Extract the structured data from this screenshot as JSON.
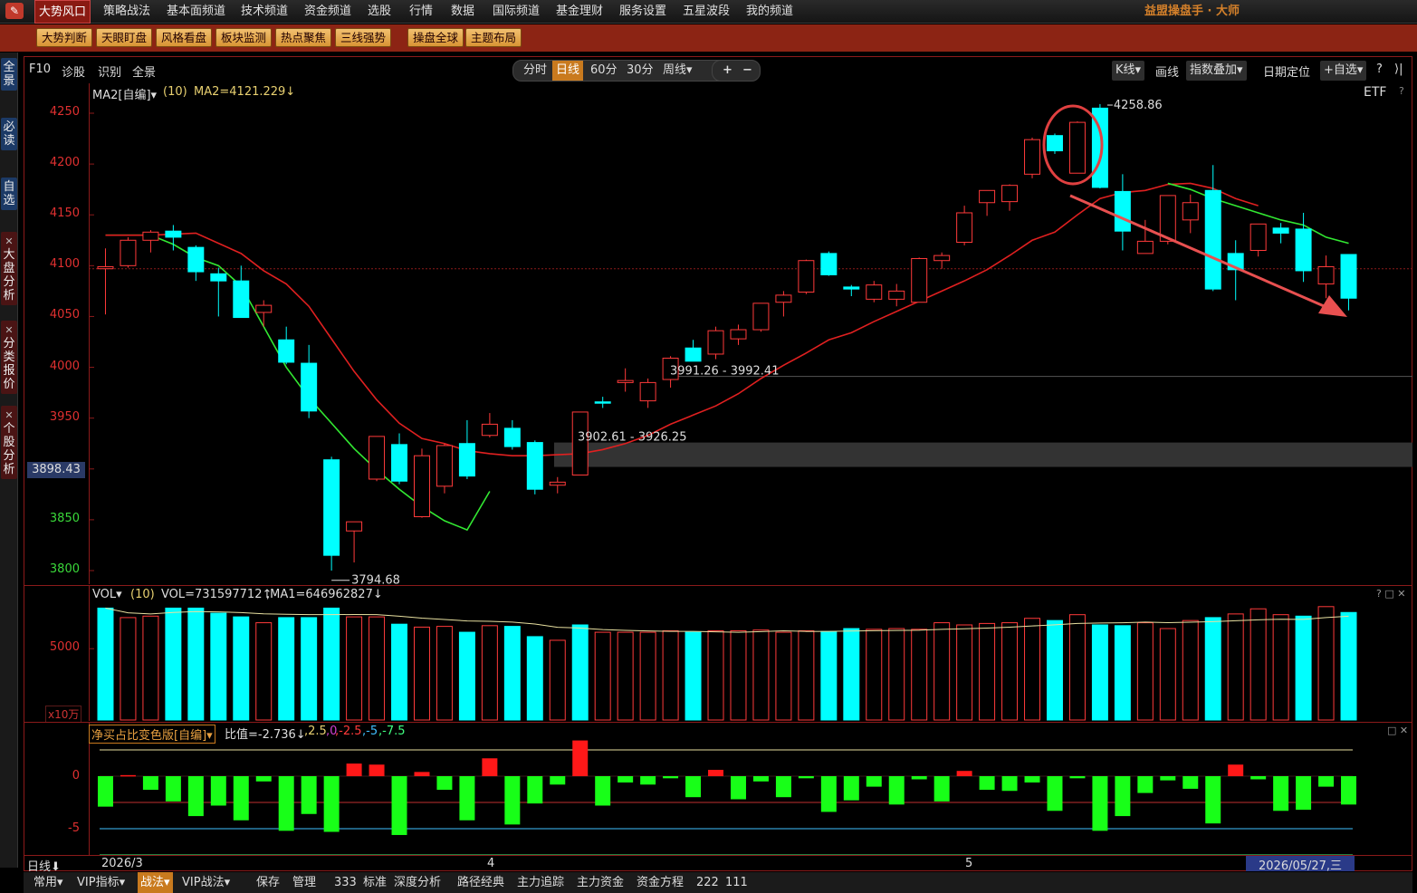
{
  "menu": {
    "items": [
      "大势风口",
      "策略战法",
      "基本面频道",
      "技术频道",
      "资金频道",
      "选股",
      "行情",
      "数据",
      "国际频道",
      "基金理财",
      "服务设置",
      "五星波段",
      "我的频道"
    ],
    "brand": "益盟操盘手 · 大师"
  },
  "subbar": {
    "buttons": [
      "大势判断",
      "天眼盯盘",
      "风格看盘",
      "板块监测",
      "热点聚焦",
      "三线强势",
      "操盘全球",
      "主题布局"
    ]
  },
  "sidebar": {
    "tabs": [
      "全景",
      "必读",
      "自选",
      "大盘分析",
      "分类报价",
      "个股分析"
    ]
  },
  "charttool": {
    "left": [
      "F10",
      "诊股",
      "识别",
      "全景"
    ],
    "periods": [
      "分时",
      "日线",
      "60分",
      "30分",
      "周线▾"
    ],
    "active_period": "日线",
    "zoom": [
      "+",
      "−"
    ],
    "right": {
      "kline": "K线▾",
      "draw": "画线",
      "overlay": "指数叠加▾",
      "date_locate": "日期定位",
      "add_watch": "+自选▾",
      "help": "?",
      "collapse": "⟩|"
    }
  },
  "kpanel": {
    "ma_label": "MA2[自编]▾",
    "ma_period": "(10)",
    "ma_value": "MA2=4121.229↓",
    "etf": "ETF",
    "help": "?",
    "yticks": [
      "4250",
      "4200",
      "4150",
      "4100",
      "4050",
      "4000",
      "3950",
      "3900",
      "3850",
      "3800"
    ],
    "current_price": "3898.43",
    "annotations": {
      "high": "4258.86",
      "low": "3794.68",
      "gap1": "3991.26 - 3992.41",
      "gap2": "3902.61 - 3926.25"
    }
  },
  "volpanel": {
    "label": "VOL▾",
    "period": "(10)",
    "vol": "VOL=731597712↑",
    "ma1": ",MA1=646962827↓",
    "ytick": "5000",
    "unit": "x10万",
    "controls": "? □ ✕"
  },
  "indpanel": {
    "name": "净买占比变色版[自编]▾",
    "ratio": "比值=-2.736↓",
    "levels": [
      ",2.5",
      ",0",
      ",-2.5",
      ",-5",
      ",-7.5"
    ],
    "yticks": [
      "0",
      "-5"
    ],
    "controls": "□ ✕"
  },
  "dateaxis": {
    "period": "日线⬇",
    "labels": [
      "2026/3",
      "4",
      "5"
    ],
    "cursor_date": "2026/05/27,三"
  },
  "bottombar": {
    "items": [
      "常用▾",
      "VIP指标▾",
      "战法▾",
      "VIP战法▾",
      "保存",
      "管理",
      "333",
      "标准",
      "深度分析",
      "路径经典",
      "主力追踪",
      "主力资金",
      "资金方程",
      "222",
      "111"
    ],
    "active": "战法▾"
  },
  "colors": {
    "up": "#ff3a3a",
    "down": "#00ffff",
    "ma_green": "#32e832",
    "ma_red": "#e02020",
    "accent": "#c97a1e",
    "frame": "#8b1a1a"
  },
  "chart_data": {
    "type": "candlestick",
    "price_range": [
      3780,
      4265
    ],
    "candles": [
      {
        "o": 4097,
        "h": 4117,
        "l": 4052,
        "c": 4099
      },
      {
        "o": 4100,
        "h": 4128,
        "l": 4098,
        "c": 4125
      },
      {
        "o": 4125,
        "h": 4135,
        "l": 4113,
        "c": 4133
      },
      {
        "o": 4134,
        "h": 4140,
        "l": 4115,
        "c": 4128
      },
      {
        "o": 4118,
        "h": 4120,
        "l": 4085,
        "c": 4094
      },
      {
        "o": 4092,
        "h": 4098,
        "l": 4050,
        "c": 4085
      },
      {
        "o": 4085,
        "h": 4100,
        "l": 4058,
        "c": 4049
      },
      {
        "o": 4054,
        "h": 4066,
        "l": 4040,
        "c": 4061
      },
      {
        "o": 4027,
        "h": 4040,
        "l": 4003,
        "c": 4005
      },
      {
        "o": 4004,
        "h": 4022,
        "l": 3950,
        "c": 3957
      },
      {
        "o": 3909,
        "h": 3912,
        "l": 3800,
        "c": 3815
      },
      {
        "o": 3839,
        "h": 3846,
        "l": 3808,
        "c": 3848
      },
      {
        "o": 3890,
        "h": 3932,
        "l": 3888,
        "c": 3932
      },
      {
        "o": 3924,
        "h": 3935,
        "l": 3885,
        "c": 3888
      },
      {
        "o": 3853,
        "h": 3920,
        "l": 3852,
        "c": 3913
      },
      {
        "o": 3883,
        "h": 3925,
        "l": 3876,
        "c": 3923
      },
      {
        "o": 3925,
        "h": 3948,
        "l": 3890,
        "c": 3893
      },
      {
        "o": 3933,
        "h": 3955,
        "l": 3931,
        "c": 3944
      },
      {
        "o": 3940,
        "h": 3948,
        "l": 3919,
        "c": 3922
      },
      {
        "o": 3926,
        "h": 3928,
        "l": 3875,
        "c": 3880
      },
      {
        "o": 3884,
        "h": 3892,
        "l": 3876,
        "c": 3887
      },
      {
        "o": 3894,
        "h": 3956,
        "l": 3894,
        "c": 3956
      },
      {
        "o": 3966,
        "h": 3971,
        "l": 3960,
        "c": 3965
      },
      {
        "o": 3985,
        "h": 3999,
        "l": 3976,
        "c": 3987
      },
      {
        "o": 3967,
        "h": 3989,
        "l": 3960,
        "c": 3985
      },
      {
        "o": 3988,
        "h": 4011,
        "l": 3980,
        "c": 4009
      },
      {
        "o": 4019,
        "h": 4027,
        "l": 4011,
        "c": 4006
      },
      {
        "o": 4013,
        "h": 4040,
        "l": 4008,
        "c": 4036
      },
      {
        "o": 4028,
        "h": 4042,
        "l": 4022,
        "c": 4037
      },
      {
        "o": 4037,
        "h": 4063,
        "l": 4035,
        "c": 4063
      },
      {
        "o": 4064,
        "h": 4075,
        "l": 4050,
        "c": 4071
      },
      {
        "o": 4074,
        "h": 4106,
        "l": 4072,
        "c": 4105
      },
      {
        "o": 4112,
        "h": 4114,
        "l": 4090,
        "c": 4091
      },
      {
        "o": 4079,
        "h": 4081,
        "l": 4070,
        "c": 4077
      },
      {
        "o": 4067,
        "h": 4085,
        "l": 4064,
        "c": 4081
      },
      {
        "o": 4067,
        "h": 4082,
        "l": 4060,
        "c": 4075
      },
      {
        "o": 4064,
        "h": 4108,
        "l": 4064,
        "c": 4107
      },
      {
        "o": 4105,
        "h": 4113,
        "l": 4097,
        "c": 4110
      },
      {
        "o": 4123,
        "h": 4159,
        "l": 4120,
        "c": 4152
      },
      {
        "o": 4162,
        "h": 4173,
        "l": 4149,
        "c": 4174
      },
      {
        "o": 4163,
        "h": 4180,
        "l": 4154,
        "c": 4179
      },
      {
        "o": 4190,
        "h": 4226,
        "l": 4186,
        "c": 4224
      },
      {
        "o": 4228,
        "h": 4230,
        "l": 4210,
        "c": 4213
      },
      {
        "o": 4191,
        "h": 4242,
        "l": 4191,
        "c": 4241
      },
      {
        "o": 4255,
        "h": 4259,
        "l": 4176,
        "c": 4177
      },
      {
        "o": 4173,
        "h": 4190,
        "l": 4115,
        "c": 4134
      },
      {
        "o": 4112,
        "h": 4145,
        "l": 4115,
        "c": 4124
      },
      {
        "o": 4124,
        "h": 4169,
        "l": 4121,
        "c": 4169
      },
      {
        "o": 4145,
        "h": 4170,
        "l": 4132,
        "c": 4162
      },
      {
        "o": 4174,
        "h": 4199,
        "l": 4075,
        "c": 4077
      },
      {
        "o": 4112,
        "h": 4125,
        "l": 4066,
        "c": 4096
      },
      {
        "o": 4115,
        "h": 4141,
        "l": 4109,
        "c": 4141
      },
      {
        "o": 4137,
        "h": 4142,
        "l": 4122,
        "c": 4132
      },
      {
        "o": 4136,
        "h": 4152,
        "l": 4084,
        "c": 4095
      },
      {
        "o": 4082,
        "h": 4110,
        "l": 4068,
        "c": 4099
      },
      {
        "o": 4111,
        "h": 4111,
        "l": 4056,
        "c": 4068
      }
    ],
    "ma_red": [
      4130,
      4130,
      4130,
      4131,
      4132,
      4122,
      4112,
      4095,
      4082,
      4060,
      4028,
      3996,
      3968,
      3945,
      3930,
      3925,
      3918,
      3915,
      3913,
      3913,
      3914,
      3915,
      3919,
      3925,
      3933,
      3944,
      3953,
      3962,
      3974,
      3989,
      4002,
      4014,
      4027,
      4034,
      4045,
      4055,
      4065,
      4075,
      4085,
      4096,
      4110,
      4125,
      4133,
      4150,
      4166,
      4172,
      4174,
      4180,
      4181,
      4176,
      4166,
      4159
    ],
    "ma_green": [
      4130,
      4130,
      4130,
      4121,
      4108,
      4100,
      4080,
      4040,
      4000,
      3970,
      3945,
      3920,
      3899,
      3880,
      3863,
      3849,
      3840,
      3878
    ],
    "volume": [
      765,
      700,
      710,
      765,
      765,
      730,
      705,
      665,
      700,
      700,
      765,
      705,
      705,
      655,
      635,
      640,
      600,
      645,
      640,
      570,
      545,
      650,
      600,
      600,
      600,
      610,
      600,
      610,
      610,
      615,
      600,
      610,
      605,
      625,
      620,
      625,
      620,
      665,
      650,
      660,
      665,
      695,
      680,
      720,
      650,
      645,
      665,
      625,
      680,
      700,
      725,
      760,
      720,
      710,
      775,
      735
    ],
    "vol_color": [
      "d",
      "u",
      "u",
      "d",
      "d",
      "d",
      "d",
      "u",
      "d",
      "d",
      "d",
      "u",
      "u",
      "d",
      "u",
      "u",
      "d",
      "u",
      "d",
      "d",
      "u",
      "d",
      "u",
      "u",
      "u",
      "u",
      "d",
      "u",
      "u",
      "u",
      "u",
      "u",
      "d",
      "d",
      "u",
      "u",
      "u",
      "u",
      "u",
      "u",
      "u",
      "u",
      "d",
      "u",
      "d",
      "d",
      "u",
      "u",
      "u",
      "d",
      "u",
      "u",
      "u",
      "d",
      "u",
      "d"
    ],
    "indicator": [
      -2.9,
      0.1,
      -1.3,
      -2.4,
      -3.8,
      -2.8,
      -4.2,
      -0.5,
      -5.2,
      -3.6,
      -5.3,
      1.2,
      1.1,
      -5.6,
      0.4,
      -1.3,
      -4.2,
      1.7,
      -4.6,
      -2.6,
      -0.8,
      3.4,
      -2.8,
      -0.6,
      -0.8,
      -0.2,
      -2.0,
      0.6,
      -2.2,
      -0.5,
      -2.0,
      -0.2,
      -3.4,
      -2.3,
      -1.0,
      -2.7,
      -0.3,
      -2.4,
      0.5,
      -1.3,
      -1.4,
      -0.6,
      -3.3,
      -0.2,
      -5.2,
      -3.8,
      -1.6,
      -0.4,
      -1.2,
      -4.5,
      1.1,
      -0.3,
      -3.3,
      -3.2,
      -1.0,
      -2.7
    ],
    "date_labels": [
      "2026/3",
      "4",
      "5"
    ],
    "annotations": [
      "4258.86",
      "3794.68",
      "3991.26 - 3992.41",
      "3902.61 - 3926.25"
    ]
  }
}
